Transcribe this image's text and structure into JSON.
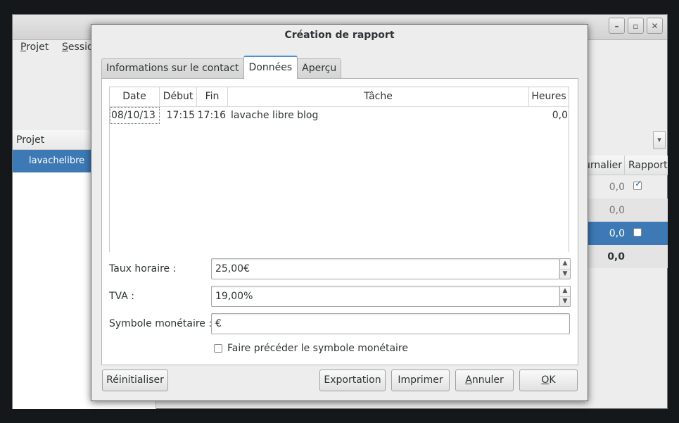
{
  "main_window": {
    "menu": {
      "projet": "P",
      "projet_rest": "rojet",
      "session": "S",
      "session_rest": "essio"
    },
    "controls": {
      "minimize": "–",
      "maximize": "▫",
      "close": "✕"
    },
    "project_panel": {
      "header": "Projet",
      "items": [
        "lavachelibre"
      ]
    },
    "combo_arrow": "▾",
    "right_table": {
      "headers": [
        "urnalier",
        "Rapport"
      ],
      "rows": [
        {
          "value": "0,0",
          "checked": true
        },
        {
          "value": "0,0",
          "checked": null
        },
        {
          "value": "0,0",
          "checked": false
        }
      ],
      "total": "0,0"
    }
  },
  "dialog": {
    "title": "Création de rapport",
    "tabs": [
      "Informations sur le contact",
      "Données",
      "Aperçu"
    ],
    "active_tab": 1,
    "table": {
      "headers": [
        "Date",
        "Début",
        "Fin",
        "Tâche",
        "Heures"
      ],
      "rows": [
        {
          "date": "08/10/13",
          "debut": "17:15",
          "fin": "17:16",
          "tache": "lavache libre blog",
          "heures": "0,0"
        }
      ]
    },
    "form": {
      "taux_label": "Taux horaire :",
      "taux_value": "25,00€",
      "tva_label": "TVA :",
      "tva_value": "19,00%",
      "symbole_label": "Symbole monétaire :",
      "symbole_value": "€",
      "precede_label": "Faire précéder le symbole monétaire",
      "precede_checked": false
    },
    "buttons": {
      "reinitialiser": "Réinitialiser",
      "exportation": "Exportation",
      "imprimer": "Imprimer",
      "annuler_key": "A",
      "annuler_rest": "nnuler",
      "ok_key": "O",
      "ok_rest": "K"
    }
  }
}
